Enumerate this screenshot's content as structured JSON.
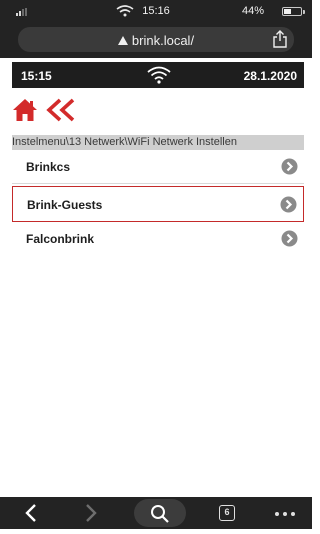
{
  "status_bar": {
    "time": "15:16",
    "battery_percent": "44%",
    "battery_level": 0.44
  },
  "browser": {
    "url": "brink.local/",
    "lock_icon": "warning-icon",
    "share_icon": "share-icon",
    "open_tabs": "6"
  },
  "app_header": {
    "time": "15:15",
    "date": "28.1.2020",
    "wifi_icon": "wifi-icon"
  },
  "nav": {
    "home_icon": "home-icon",
    "back_icon": "double-chevron-left-icon"
  },
  "breadcrumb": "Instelmenu\\13 Netwerk\\WiFi Netwerk Instellen",
  "networks": [
    {
      "label": "Brinkcs",
      "selected": false
    },
    {
      "label": "Brink-Guests",
      "selected": true
    },
    {
      "label": "Falconbrink",
      "selected": false
    }
  ],
  "colors": {
    "accent_red": "#d32b2b",
    "header_bg": "#1e1e1e",
    "breadcrumb_bg": "#cfcfcf",
    "chevron_grey": "#8a8a8a"
  }
}
